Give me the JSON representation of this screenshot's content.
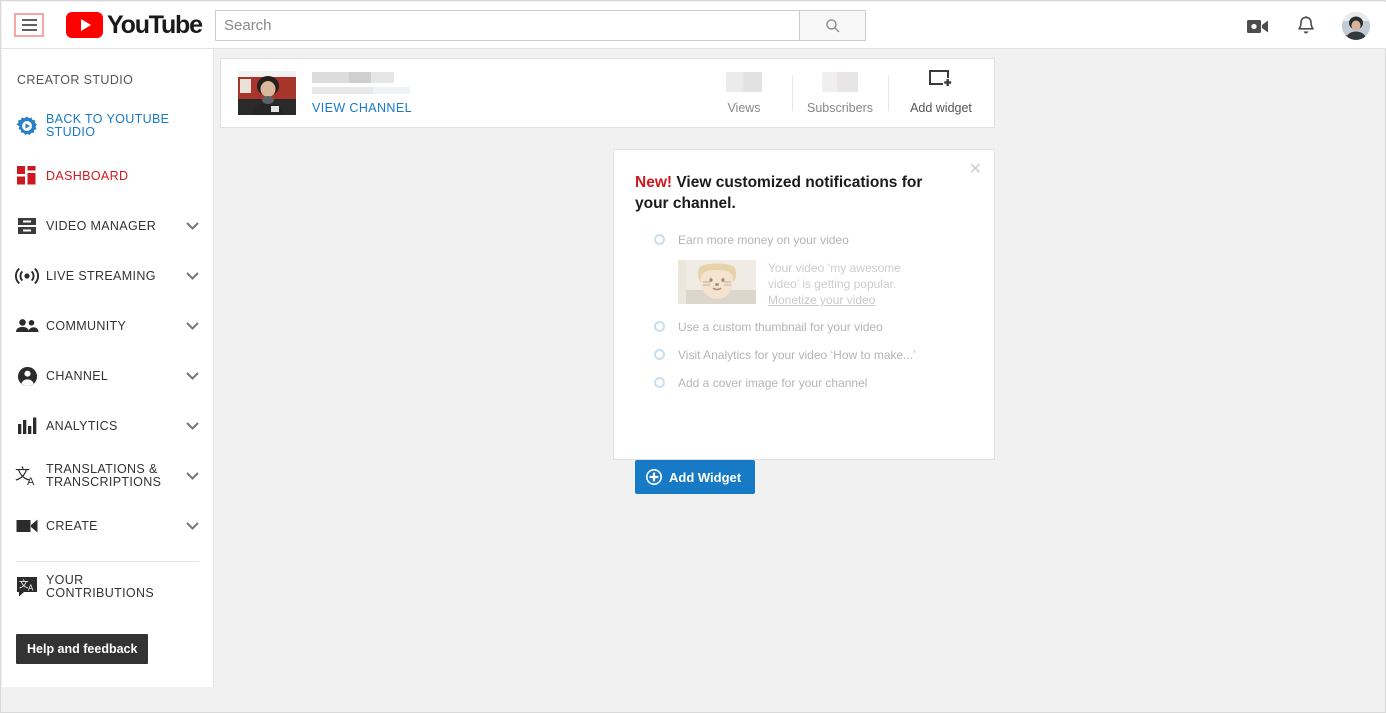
{
  "header": {
    "menu_icon": "hamburger-menu-icon",
    "logo_text": "YouTube",
    "search": {
      "placeholder": "Search",
      "value": "",
      "button_icon": "search-icon"
    },
    "upload_icon": "video-upload-icon",
    "notifications_icon": "bell-icon",
    "avatar": "user-avatar"
  },
  "sidebar": {
    "title": "CREATOR STUDIO",
    "items": [
      {
        "label": "BACK TO YOUTUBE STUDIO",
        "icon": "gear-play-icon",
        "style": "blue",
        "expandable": false
      },
      {
        "label": "DASHBOARD",
        "icon": "dashboard-grid-icon",
        "style": "red",
        "expandable": false
      },
      {
        "label": "VIDEO MANAGER",
        "icon": "video-manager-icon",
        "style": "default",
        "expandable": true
      },
      {
        "label": "LIVE STREAMING",
        "icon": "live-broadcast-icon",
        "style": "default",
        "expandable": true
      },
      {
        "label": "COMMUNITY",
        "icon": "people-icon",
        "style": "default",
        "expandable": true
      },
      {
        "label": "CHANNEL",
        "icon": "person-circle-icon",
        "style": "default",
        "expandable": true
      },
      {
        "label": "ANALYTICS",
        "icon": "bar-chart-icon",
        "style": "default",
        "expandable": true
      },
      {
        "label": "TRANSLATIONS & TRANSCRIPTIONS",
        "icon": "translate-icon",
        "style": "default",
        "expandable": true
      },
      {
        "label": "CREATE",
        "icon": "video-camera-icon",
        "style": "default",
        "expandable": true
      }
    ],
    "contributions": {
      "label": "YOUR CONTRIBUTIONS",
      "icon": "translate-badge-icon"
    },
    "help_button": "Help and feedback"
  },
  "channel_card": {
    "thumbnail": "channel-avatar-photo",
    "channel_name_redacted": true,
    "view_channel_link": "VIEW CHANNEL",
    "stats": [
      {
        "label": "Views",
        "value_redacted": true
      },
      {
        "label": "Subscribers",
        "value_redacted": true
      }
    ],
    "add_widget": {
      "label": "Add widget",
      "icon": "add-widget-icon"
    }
  },
  "notification_card": {
    "close_icon": "close-icon",
    "title_badge": "New!",
    "title": " View customized notifications for your channel.",
    "preview_items": [
      "Earn more money on your video",
      "Use a custom thumbnail for your video",
      "Visit Analytics for your video  ‘How to make...’",
      "Add a cover image for your channel"
    ],
    "detail": {
      "thumbnail": "video-thumbnail-preview",
      "line1": "Your video ‘my awesome",
      "line2": "video’ is getting popular.",
      "link": "Monetize your video"
    },
    "button": {
      "label": "Add Widget",
      "icon": "plus-circle-icon"
    }
  },
  "colors": {
    "youtube_red": "#ff0000",
    "link_blue": "#167ac6",
    "dashboard_red": "#cc181e",
    "page_background": "#f1f1f1"
  }
}
